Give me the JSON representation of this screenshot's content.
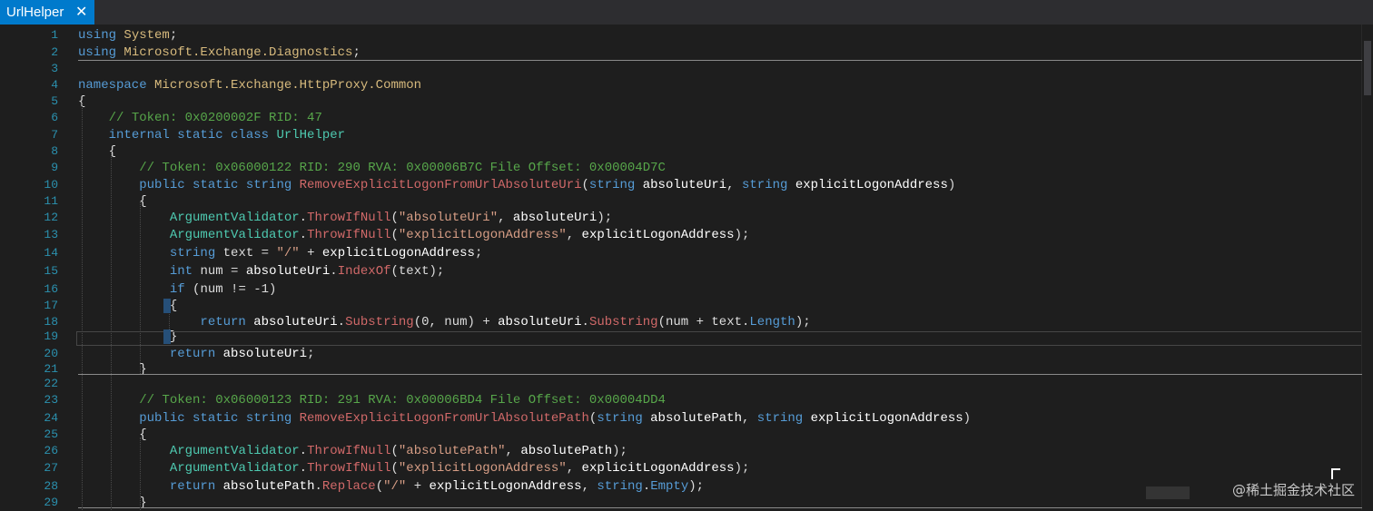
{
  "tab": {
    "title": "UrlHelper",
    "close_icon": "close-icon"
  },
  "watermark": "@稀土掘金技术社区",
  "lines": [
    {
      "n": "1",
      "tokens": [
        [
          "kw",
          "using"
        ],
        [
          "p",
          " "
        ],
        [
          "ns",
          "System"
        ],
        [
          "p",
          ";"
        ]
      ]
    },
    {
      "n": "2",
      "tokens": [
        [
          "kw",
          "using"
        ],
        [
          "p",
          " "
        ],
        [
          "ns",
          "Microsoft.Exchange.Diagnostics"
        ],
        [
          "p",
          ";"
        ]
      ]
    },
    {
      "n": "3",
      "tokens": []
    },
    {
      "n": "4",
      "tokens": [
        [
          "kw",
          "namespace"
        ],
        [
          "p",
          " "
        ],
        [
          "ns",
          "Microsoft.Exchange.HttpProxy.Common"
        ]
      ]
    },
    {
      "n": "5",
      "tokens": [
        [
          "p",
          "{"
        ]
      ]
    },
    {
      "n": "6",
      "tokens": [
        [
          "p",
          "    "
        ],
        [
          "cm",
          "// Token: 0x0200002F RID: 47"
        ]
      ]
    },
    {
      "n": "7",
      "tokens": [
        [
          "p",
          "    "
        ],
        [
          "kw",
          "internal static class"
        ],
        [
          "p",
          " "
        ],
        [
          "ty",
          "UrlHelper"
        ]
      ]
    },
    {
      "n": "8",
      "tokens": [
        [
          "p",
          "    {"
        ]
      ]
    },
    {
      "n": "9",
      "tokens": [
        [
          "p",
          "        "
        ],
        [
          "cm",
          "// Token: 0x06000122 RID: 290 RVA: 0x00006B7C File Offset: 0x00004D7C"
        ]
      ]
    },
    {
      "n": "10",
      "tokens": [
        [
          "p",
          "        "
        ],
        [
          "kw",
          "public static string"
        ],
        [
          "p",
          " "
        ],
        [
          "mt",
          "RemoveExplicitLogonFromUrlAbsoluteUri"
        ],
        [
          "p",
          "("
        ],
        [
          "kw",
          "string"
        ],
        [
          "p",
          " "
        ],
        [
          "pm",
          "absoluteUri"
        ],
        [
          "p",
          ", "
        ],
        [
          "kw",
          "string"
        ],
        [
          "p",
          " "
        ],
        [
          "pm",
          "explicitLogonAddress"
        ],
        [
          "p",
          ")"
        ]
      ]
    },
    {
      "n": "11",
      "tokens": [
        [
          "p",
          "        {"
        ]
      ]
    },
    {
      "n": "12",
      "tokens": [
        [
          "p",
          "            "
        ],
        [
          "ty",
          "ArgumentValidator"
        ],
        [
          "p",
          "."
        ],
        [
          "mt",
          "ThrowIfNull"
        ],
        [
          "p",
          "("
        ],
        [
          "st",
          "\"absoluteUri\""
        ],
        [
          "p",
          ", "
        ],
        [
          "pm",
          "absoluteUri"
        ],
        [
          "p",
          ");"
        ]
      ]
    },
    {
      "n": "13",
      "tokens": [
        [
          "p",
          "            "
        ],
        [
          "ty",
          "ArgumentValidator"
        ],
        [
          "p",
          "."
        ],
        [
          "mt",
          "ThrowIfNull"
        ],
        [
          "p",
          "("
        ],
        [
          "st",
          "\"explicitLogonAddress\""
        ],
        [
          "p",
          ", "
        ],
        [
          "pm",
          "explicitLogonAddress"
        ],
        [
          "p",
          ");"
        ]
      ]
    },
    {
      "n": "14",
      "tokens": [
        [
          "p",
          "            "
        ],
        [
          "kw",
          "string"
        ],
        [
          "p",
          " text = "
        ],
        [
          "st",
          "\"/\""
        ],
        [
          "p",
          " + "
        ],
        [
          "pm",
          "explicitLogonAddress"
        ],
        [
          "p",
          ";"
        ]
      ]
    },
    {
      "n": "15",
      "tokens": [
        [
          "p",
          "            "
        ],
        [
          "kw",
          "int"
        ],
        [
          "p",
          " num = "
        ],
        [
          "pm",
          "absoluteUri"
        ],
        [
          "p",
          "."
        ],
        [
          "mt",
          "IndexOf"
        ],
        [
          "p",
          "(text);"
        ]
      ]
    },
    {
      "n": "16",
      "tokens": [
        [
          "p",
          "            "
        ],
        [
          "kw",
          "if"
        ],
        [
          "p",
          " (num != -1)"
        ]
      ]
    },
    {
      "n": "17",
      "tokens": [
        [
          "p",
          "            {"
        ]
      ]
    },
    {
      "n": "18",
      "tokens": [
        [
          "p",
          "                "
        ],
        [
          "kw",
          "return"
        ],
        [
          "p",
          " "
        ],
        [
          "pm",
          "absoluteUri"
        ],
        [
          "p",
          "."
        ],
        [
          "mt",
          "Substring"
        ],
        [
          "p",
          "(0, num) + "
        ],
        [
          "pm",
          "absoluteUri"
        ],
        [
          "p",
          "."
        ],
        [
          "mt",
          "Substring"
        ],
        [
          "p",
          "(num + text."
        ],
        [
          "pr",
          "Length"
        ],
        [
          "p",
          ");"
        ]
      ]
    },
    {
      "n": "19",
      "tokens": [
        [
          "p",
          "            }"
        ]
      ]
    },
    {
      "n": "20",
      "tokens": [
        [
          "p",
          "            "
        ],
        [
          "kw",
          "return"
        ],
        [
          "p",
          " "
        ],
        [
          "pm",
          "absoluteUri"
        ],
        [
          "p",
          ";"
        ]
      ]
    },
    {
      "n": "21",
      "tokens": [
        [
          "p",
          "        }"
        ]
      ]
    },
    {
      "n": "22",
      "tokens": []
    },
    {
      "n": "23",
      "tokens": [
        [
          "p",
          "        "
        ],
        [
          "cm",
          "// Token: 0x06000123 RID: 291 RVA: 0x00006BD4 File Offset: 0x00004DD4"
        ]
      ]
    },
    {
      "n": "24",
      "tokens": [
        [
          "p",
          "        "
        ],
        [
          "kw",
          "public static string"
        ],
        [
          "p",
          " "
        ],
        [
          "mt",
          "RemoveExplicitLogonFromUrlAbsolutePath"
        ],
        [
          "p",
          "("
        ],
        [
          "kw",
          "string"
        ],
        [
          "p",
          " "
        ],
        [
          "pm",
          "absolutePath"
        ],
        [
          "p",
          ", "
        ],
        [
          "kw",
          "string"
        ],
        [
          "p",
          " "
        ],
        [
          "pm",
          "explicitLogonAddress"
        ],
        [
          "p",
          ")"
        ]
      ]
    },
    {
      "n": "25",
      "tokens": [
        [
          "p",
          "        {"
        ]
      ]
    },
    {
      "n": "26",
      "tokens": [
        [
          "p",
          "            "
        ],
        [
          "ty",
          "ArgumentValidator"
        ],
        [
          "p",
          "."
        ],
        [
          "mt",
          "ThrowIfNull"
        ],
        [
          "p",
          "("
        ],
        [
          "st",
          "\"absolutePath\""
        ],
        [
          "p",
          ", "
        ],
        [
          "pm",
          "absolutePath"
        ],
        [
          "p",
          ");"
        ]
      ]
    },
    {
      "n": "27",
      "tokens": [
        [
          "p",
          "            "
        ],
        [
          "ty",
          "ArgumentValidator"
        ],
        [
          "p",
          "."
        ],
        [
          "mt",
          "ThrowIfNull"
        ],
        [
          "p",
          "("
        ],
        [
          "st",
          "\"explicitLogonAddress\""
        ],
        [
          "p",
          ", "
        ],
        [
          "pm",
          "explicitLogonAddress"
        ],
        [
          "p",
          ");"
        ]
      ]
    },
    {
      "n": "28",
      "tokens": [
        [
          "p",
          "            "
        ],
        [
          "kw",
          "return"
        ],
        [
          "p",
          " "
        ],
        [
          "pm",
          "absolutePath"
        ],
        [
          "p",
          "."
        ],
        [
          "mt",
          "Replace"
        ],
        [
          "p",
          "("
        ],
        [
          "st",
          "\"/\""
        ],
        [
          "p",
          " + "
        ],
        [
          "pm",
          "explicitLogonAddress"
        ],
        [
          "p",
          ", "
        ],
        [
          "kw",
          "string"
        ],
        [
          "p",
          "."
        ],
        [
          "pr",
          "Empty"
        ],
        [
          "p",
          ");"
        ]
      ]
    },
    {
      "n": "29",
      "tokens": [
        [
          "p",
          "        }"
        ]
      ]
    }
  ]
}
